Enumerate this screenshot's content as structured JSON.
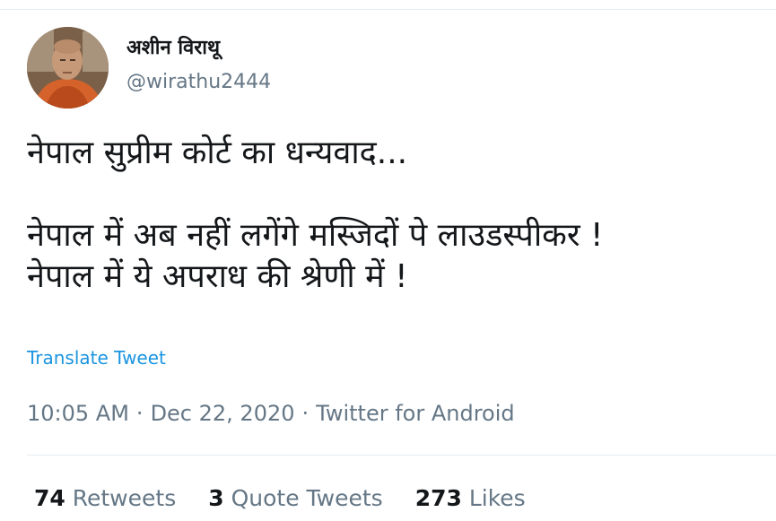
{
  "author": {
    "display_name": "अशीन विराथू",
    "handle": "@wirathu2444",
    "avatar_icon": "profile-photo-monk"
  },
  "tweet": {
    "lines": [
      "नेपाल सुप्रीम कोर्ट का धन्यवाद...",
      "",
      "नेपाल में अब नहीं लगेंगे मस्जिदों पे लाउडस्पीकर !",
      "नेपाल में ये अपराध की श्रेणी में !"
    ],
    "translate_label": "Translate Tweet",
    "time": "10:05 AM",
    "date": "Dec 22, 2020",
    "source": "Twitter for Android",
    "separator": "·"
  },
  "stats": {
    "retweets_count": "74",
    "retweets_label": "Retweets",
    "quotes_count": "3",
    "quotes_label": "Quote Tweets",
    "likes_count": "273",
    "likes_label": "Likes"
  },
  "colors": {
    "link": "#1b95e0",
    "muted": "#657786",
    "text": "#14171a",
    "border": "#e6ecf0"
  }
}
